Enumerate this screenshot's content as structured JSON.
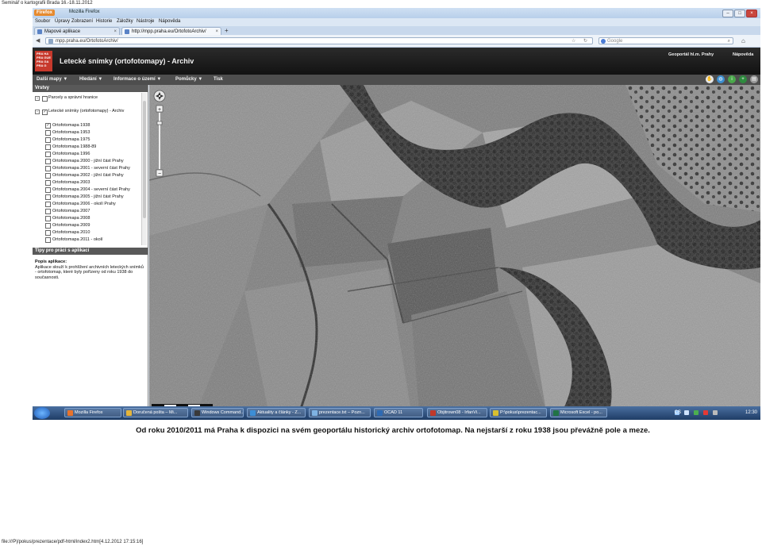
{
  "page_header": "Seminář o kartografii Brada 16.-18.11.2012",
  "page_footer": "file:///P|/pokus/prezentace/pdf-html/index2.htm[4.12.2012 17:15:16]",
  "caption": "Od roku 2010/2011 má Praha k dispozici na svém geoportálu historický archiv ortofotomap. Na nejstarší z roku 1938 jsou převážně pole a meze.",
  "browser": {
    "app_button": "Firefox",
    "window_title": "Mozilla Firefox",
    "menu": [
      "Soubor",
      "Úpravy",
      "Zobrazení",
      "Historie",
      "Záložky",
      "Nástroje",
      "Nápověda"
    ],
    "tabs": [
      {
        "label": "Mapové aplikace"
      },
      {
        "label": "http://mpp.praha.eu/OrtofotoArchiv/"
      }
    ],
    "url": "mpp.praha.eu/OrtofotoArchiv/",
    "search_placeholder": "Google"
  },
  "app": {
    "logo_text": "PRA HA PRA GUE PRA GA PRA G",
    "title": "Letecké snímky (ortofotomapy) - Archiv",
    "top_links": [
      "Geoportál hl.m. Prahy",
      "Nápověda"
    ],
    "nav": [
      "Další mapy ▼",
      "Hledání ▼",
      "Informace o území ▼",
      "Pomůcky ▼",
      "Tisk"
    ],
    "layers_header": "Vrstvy",
    "groups": [
      {
        "label": "Parcely a správní hranice"
      },
      {
        "label": "Letecké snímky (ortofotomapy) - Archiv"
      }
    ],
    "layers": [
      {
        "label": "Ortofotomapa 1938",
        "checked": true
      },
      {
        "label": "Ortofotomapa 1953",
        "checked": false
      },
      {
        "label": "Ortofotomapa 1975",
        "checked": false
      },
      {
        "label": "Ortofotomapa 1988-89",
        "checked": false
      },
      {
        "label": "Ortofotomapa 1996",
        "checked": false
      },
      {
        "label": "Ortofotomapa 2000 - jižní část Prahy",
        "checked": false
      },
      {
        "label": "Ortofotomapa 2001 - severní část Prahy",
        "checked": false
      },
      {
        "label": "Ortofotomapa 2002 - jižní část Prahy",
        "checked": false
      },
      {
        "label": "Ortofotomapa 2003",
        "checked": false
      },
      {
        "label": "Ortofotomapa 2004 - severní část Prahy",
        "checked": false
      },
      {
        "label": "Ortofotomapa 2005 - jižní část Prahy",
        "checked": false
      },
      {
        "label": "Ortofotomapa 2006 - okolí Prahy",
        "checked": false
      },
      {
        "label": "Ortofotomapa 2007",
        "checked": false
      },
      {
        "label": "Ortofotomapa 2008",
        "checked": false
      },
      {
        "label": "Ortofotomapa 2009",
        "checked": false
      },
      {
        "label": "Ortofotomapa 2010",
        "checked": false
      },
      {
        "label": "Ortofotomapa 2011 - okolí",
        "checked": false
      }
    ],
    "tips_header": "Tipy pro práci s aplikací",
    "tips_title": "Popis aplikace:",
    "tips_text": "Aplikace slouží k prohlížení archivních leteckých snímků - ortofotomap, které byly pořízeny od roku 1938 do současnosti."
  },
  "taskbar": {
    "tasks": [
      {
        "label": "Mozilla Firefox",
        "color": "#e8732c"
      },
      {
        "label": "Doručená pošta – Mi...",
        "color": "#e5b53a"
      },
      {
        "label": "Windows Command...",
        "color": "#3a3a3a"
      },
      {
        "label": "Aktuality a články - Z...",
        "color": "#3c8ed6"
      },
      {
        "label": "prezentace.txt – Pozn...",
        "color": "#7fb3e3"
      },
      {
        "label": "OCAD 11",
        "color": "#2e6ab3"
      },
      {
        "label": "Objitrown08 - IrfanVi...",
        "color": "#c0392b"
      },
      {
        "label": "P:\\pokus\\prezentac...",
        "color": "#d8c030"
      },
      {
        "label": "Microsoft Excel - po...",
        "color": "#217346"
      }
    ],
    "lang": "CS",
    "time": "12:30"
  },
  "colors": {
    "header_bg": "#1b1b1b",
    "nav_bg": "#4e4e4e",
    "logo": "#c7392c",
    "taskbar": "#2a4d7e"
  }
}
